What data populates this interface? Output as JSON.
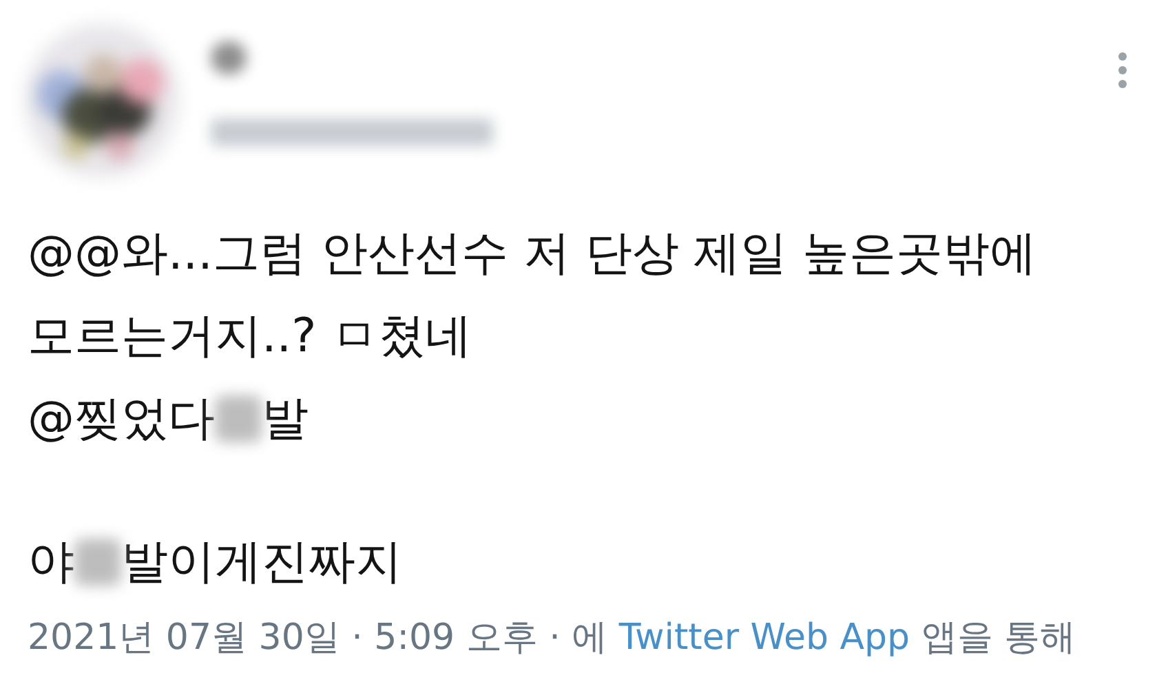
{
  "tweet": {
    "paragraphs": [
      {
        "lines": [
          [
            {
              "kind": "text",
              "text": "@@와...그럼 안산선수 저 단상 제일 높은곳밖에"
            }
          ],
          [
            {
              "kind": "text",
              "text": "모르는거지..? ㅁ쳤네"
            }
          ],
          [
            {
              "kind": "text",
              "text": "@찢었다"
            },
            {
              "kind": "blur"
            },
            {
              "kind": "text",
              "text": "발"
            }
          ]
        ]
      },
      {
        "lines": [
          [
            {
              "kind": "text",
              "text": "야"
            },
            {
              "kind": "blur"
            },
            {
              "kind": "text",
              "text": "발이게진짜지"
            }
          ]
        ]
      }
    ]
  },
  "meta": {
    "text_before": "2021년 07월 30일 · 5:09 오후 · 에",
    "source": "Twitter Web App",
    "text_after": "앱을 통해"
  }
}
